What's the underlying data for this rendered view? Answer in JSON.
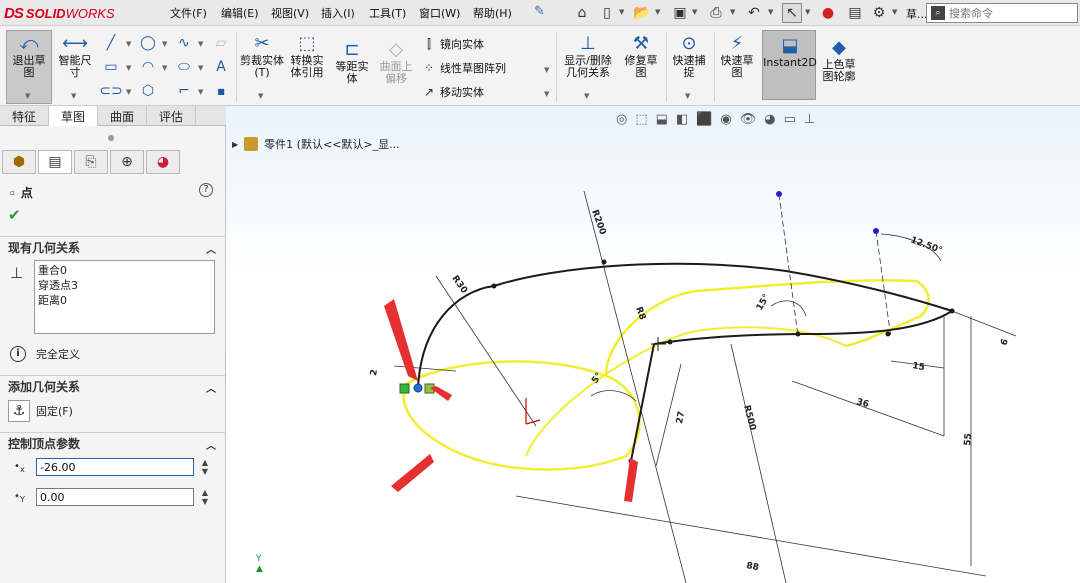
{
  "app": {
    "logo_prefix": "DS",
    "logo_solid": "SOLID",
    "logo_works": "WORKS"
  },
  "menu": [
    "文件(F)",
    "编辑(E)",
    "视图(V)",
    "插入(I)",
    "工具(T)",
    "窗口(W)",
    "帮助(H)"
  ],
  "search": {
    "placeholder": "搜索命令",
    "truncated_label": "草..."
  },
  "ribbon": {
    "exit_sketch": "退出草图",
    "smart_dim": "智能尺寸",
    "trim": "剪裁实体(T)",
    "convert": "转换实体引用",
    "offset": "等距实体",
    "surface_offset": "曲面上偏移",
    "mirror": "镜向实体",
    "linear_pattern": "线性草图阵列",
    "move": "移动实体",
    "show_delete_rel": "显示/删除几何关系",
    "repair": "修复草图",
    "quick_snap": "快速捕捉",
    "rapid_sketch": "快速草图",
    "instant2d": "Instant2D",
    "shaded_sketch": "上色草图轮廓"
  },
  "tabs": [
    "特征",
    "草图",
    "曲面",
    "评估"
  ],
  "active_tab": "草图",
  "property_manager": {
    "title": "点",
    "existing_relations": {
      "header": "现有几何关系",
      "items": [
        "重合0",
        "穿透点3",
        "距离0"
      ]
    },
    "status": "完全定义",
    "add_relations": {
      "header": "添加几何关系",
      "fix": "固定(F)"
    },
    "params": {
      "header": "控制顶点参数",
      "x_label": "x",
      "y_label": "Y",
      "x_value": "-26.00",
      "y_value": "0.00"
    }
  },
  "tree": {
    "part_label": "零件1 (默认<<默认>_显..."
  },
  "dimensions": [
    "R200",
    "R30",
    "R8",
    "R500",
    "12.50°",
    "15°",
    "6",
    "15",
    "36",
    "55",
    "27",
    "2",
    "5°",
    "88"
  ],
  "colors": {
    "highlight": "#f2ee2e",
    "sketch_line": "#1b1b1b",
    "arrow": "#e53030",
    "accent": "#1f5fa8"
  }
}
